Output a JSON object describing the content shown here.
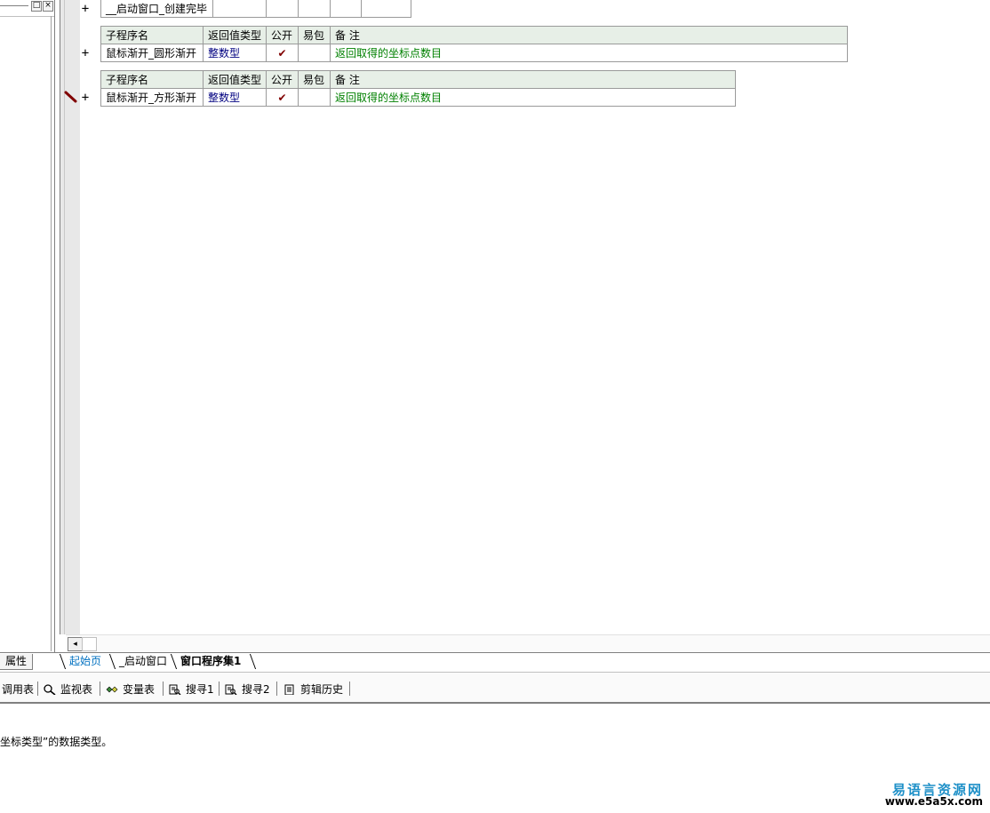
{
  "top_row": {
    "name": "__启动窗口_创建完毕"
  },
  "sub_tables": [
    {
      "headers": {
        "name": "子程序名",
        "return_type": "返回值类型",
        "public": "公开",
        "easy_pack": "易包",
        "note": "备 注"
      },
      "row": {
        "name": "鼠标渐开_圆形渐开",
        "return_type": "整数型",
        "public_check": "✔",
        "easy_pack": "",
        "note": "返回取得的坐标点数目"
      }
    },
    {
      "headers": {
        "name": "子程序名",
        "return_type": "返回值类型",
        "public": "公开",
        "easy_pack": "易包",
        "note": "备 注"
      },
      "row": {
        "name": "鼠标渐开_方形渐开",
        "return_type": "整数型",
        "public_check": "✔",
        "easy_pack": "",
        "note": "返回取得的坐标点数目"
      }
    }
  ],
  "gutter": {
    "plus": "+"
  },
  "window_buttons": {
    "restore": "□",
    "close": "×"
  },
  "scroll": {
    "left_arrow": "◂"
  },
  "tabs": {
    "properties": "属性",
    "start_page": "起始页",
    "start_window": "_启动窗口",
    "program_set": "窗口程序集1"
  },
  "toolbar": {
    "call_table": "调用表",
    "watch_table": "监视表",
    "var_table": "变量表",
    "search1": "搜寻1",
    "search2": "搜寻2",
    "clip_history": "剪辑历史"
  },
  "status": {
    "text": "坐标类型”的数据类型。"
  },
  "watermark": {
    "title": "易语言资源网",
    "url": "www.e5a5x.com"
  },
  "colors": {
    "header_bg": "#e7efe7",
    "type_text": "#000080",
    "note_text": "#008000",
    "check": "#800000",
    "watermark": "#1e90c8"
  }
}
